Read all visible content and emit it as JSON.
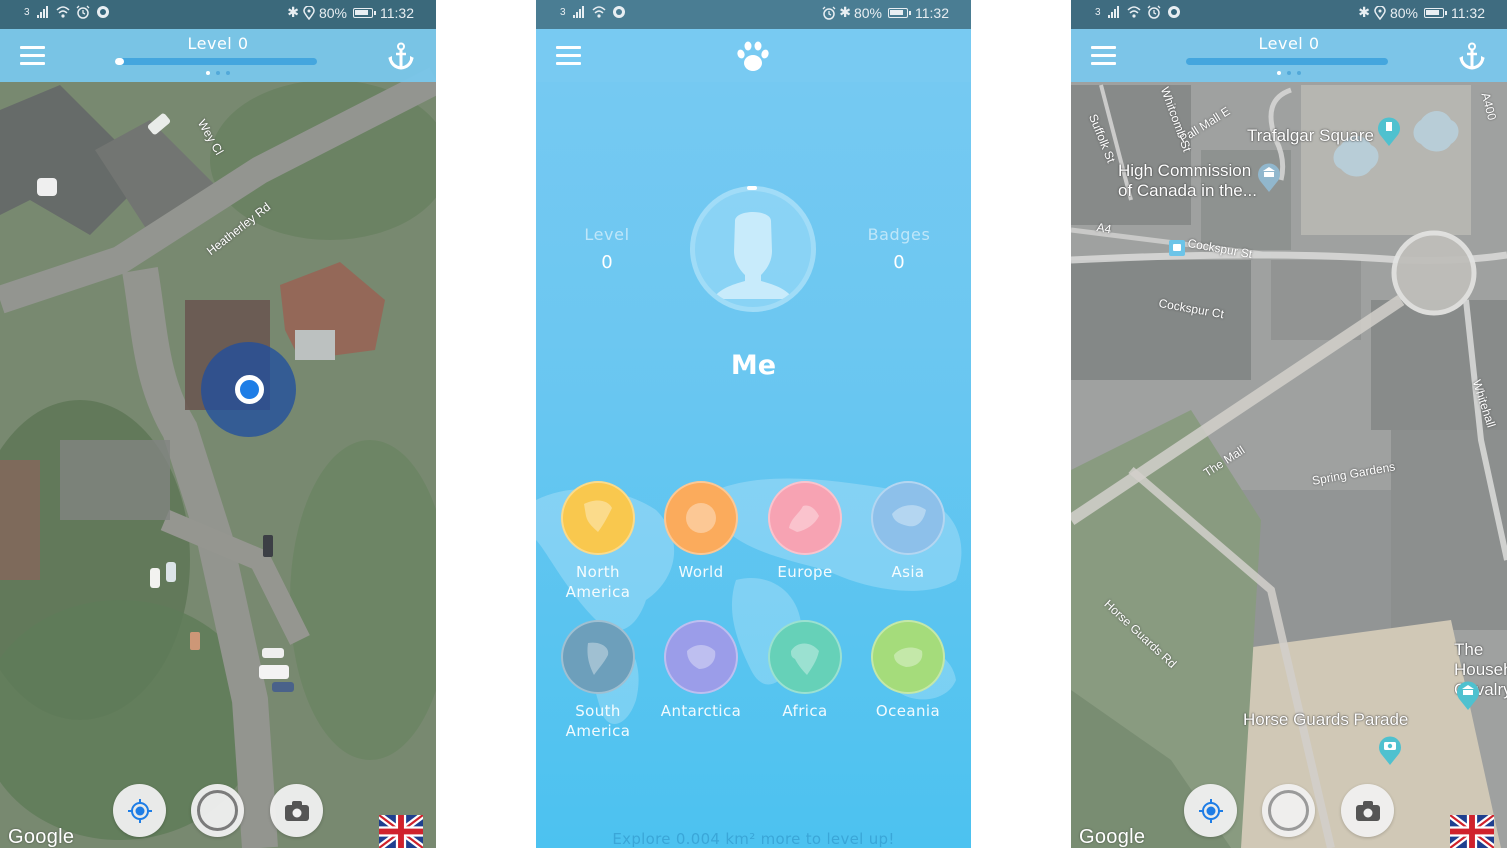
{
  "status_bar": {
    "carrier_indicator": "3",
    "battery_percent": "80%",
    "time": "11:32",
    "icons_left": [
      "signal-icon",
      "wifi-icon",
      "alarm-icon",
      "sync-icon"
    ],
    "icons_right": [
      "bluetooth-icon",
      "location-icon",
      "battery-icon"
    ]
  },
  "screens": [
    {
      "id": "map-home",
      "header": {
        "title": "Level 0",
        "progress": 0.02,
        "page_indicator": {
          "count": 3,
          "active": 0
        }
      },
      "map": {
        "street_labels": [
          "Wey Cl",
          "Heatherley Rd"
        ],
        "user_location_marker": "current-location"
      },
      "controls": [
        "locate-button",
        "record-button",
        "camera-button"
      ],
      "attribution": "Google",
      "region_flag": "United Kingdom"
    },
    {
      "id": "profile",
      "header": {
        "logo": "paw-icon"
      },
      "stats": [
        {
          "label": "Level",
          "value": "0"
        },
        {
          "label": "Badges",
          "value": "0"
        }
      ],
      "user_name": "Me",
      "continents": [
        {
          "name": "North America",
          "color": "#f9c84e",
          "icon": "north-america-icon"
        },
        {
          "name": "World",
          "color": "#fbab5c",
          "icon": "globe-icon"
        },
        {
          "name": "Europe",
          "color": "#f7a3b3",
          "icon": "europe-icon"
        },
        {
          "name": "Asia",
          "color": "#8dc0ea",
          "icon": "asia-icon"
        },
        {
          "name": "South America",
          "color": "#6d9fbb",
          "icon": "south-america-icon"
        },
        {
          "name": "Antarctica",
          "color": "#9b9de9",
          "icon": "antarctica-icon"
        },
        {
          "name": "Africa",
          "color": "#66d1b8",
          "icon": "africa-icon"
        },
        {
          "name": "Oceania",
          "color": "#a5dc7b",
          "icon": "oceania-icon"
        }
      ],
      "footer_message": "Explore 0.004 km² more to level up!"
    },
    {
      "id": "map-london",
      "header": {
        "title": "Level 0",
        "progress": 0.0,
        "page_indicator": {
          "count": 3,
          "active": 0
        }
      },
      "map": {
        "street_labels": [
          "Suffolk St",
          "Whitcomb St",
          "Pall Mall E",
          "A4",
          "Cockspur St",
          "Cockspur Ct",
          "The Mall",
          "Spring Gardens",
          "Horse Guards Rd",
          "A400",
          "Whitehall"
        ],
        "places": [
          "Trafalgar Square",
          "High Commission of Canada in the...",
          "Horse Guards Parade",
          "The Household Cavalry"
        ]
      },
      "controls": [
        "locate-button",
        "record-button",
        "camera-button"
      ],
      "attribution": "Google",
      "region_flag": "United Kingdom"
    }
  ],
  "colors": {
    "app_bar": "#7ac8ee",
    "status_bar": "#34667c",
    "progress_track": "#44a6de",
    "location_blue": "#1e7de6",
    "profile_bg": "#6cc7f1"
  }
}
